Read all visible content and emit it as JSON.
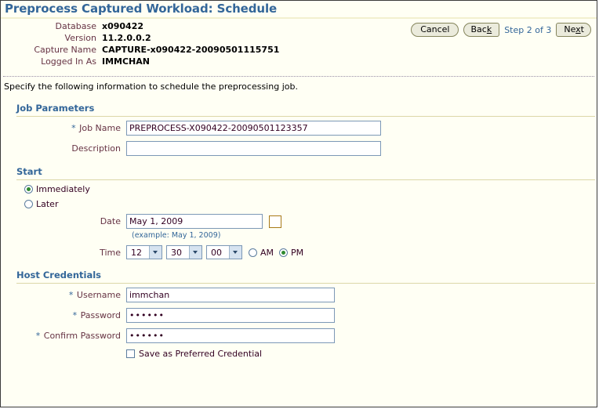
{
  "page": {
    "title": "Preprocess Captured Workload: Schedule",
    "instruction": "Specify the following information to schedule the preprocessing job."
  },
  "header": {
    "rows": [
      {
        "label": "Database",
        "value": "x090422"
      },
      {
        "label": "Version",
        "value": "11.2.0.0.2"
      },
      {
        "label": "Capture Name",
        "value": "CAPTURE-x090422-20090501115751"
      },
      {
        "label": "Logged In As",
        "value": "IMMCHAN"
      }
    ]
  },
  "toolbar": {
    "cancel_label": "Cancel",
    "back_label": "Back",
    "back_accel": "k",
    "step_text": "Step 2 of 3",
    "next_label": "Ne",
    "next_accel": "x",
    "next_tail": "t"
  },
  "job_parameters": {
    "section_title": "Job Parameters",
    "job_name_label": "Job Name",
    "job_name_value": "PREPROCESS-X090422-20090501123357",
    "description_label": "Description",
    "description_value": ""
  },
  "start": {
    "section_title": "Start",
    "immediately_label": "Immediately",
    "immediately_selected": true,
    "later_label": "Later",
    "later_selected": false,
    "date_label": "Date",
    "date_value": "May 1, 2009",
    "date_hint": "(example: May 1, 2009)",
    "calendar_icon": "calendar-icon",
    "time_label": "Time",
    "time_hour": "12",
    "time_minute": "30",
    "time_second": "00",
    "am_label": "AM",
    "pm_label": "PM",
    "am_selected": false,
    "pm_selected": true
  },
  "host_credentials": {
    "section_title": "Host Credentials",
    "username_label": "Username",
    "username_value": "immchan",
    "password_label": "Password",
    "password_value": "••••••",
    "confirm_password_label": "Confirm Password",
    "confirm_password_value": "••••••",
    "save_preferred_label": "Save as Preferred Credential",
    "save_preferred_checked": false
  },
  "colors": {
    "accent_blue": "#336699",
    "label_maroon": "#663344",
    "rule_tan": "#dcd7a8",
    "page_bg": "#fffff4",
    "field_border": "#7c98b6"
  }
}
